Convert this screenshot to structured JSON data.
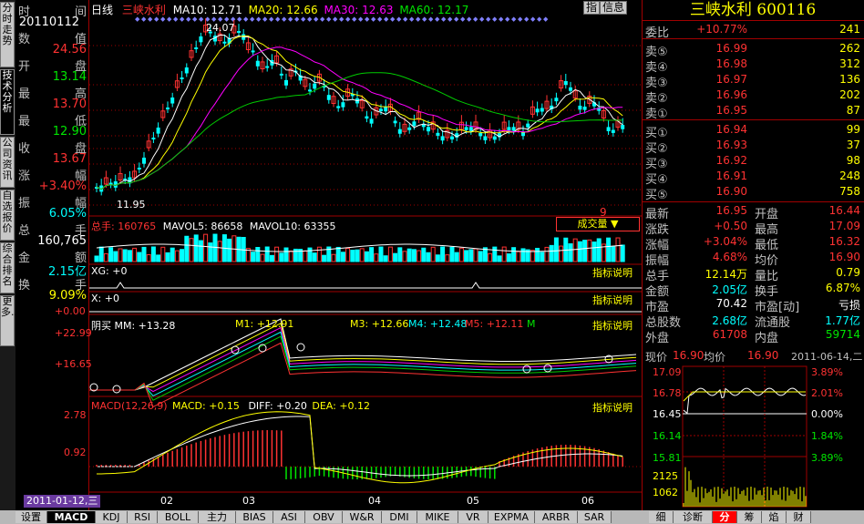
{
  "header": {
    "period_label": "日线",
    "name": "三峡水利",
    "ma10": "MA10: 12.71",
    "ma20": "MA20: 12.66",
    "ma30": "MA30: 12.63",
    "ma60": "MA60: 12.17"
  },
  "info": {
    "time_k": "时",
    "time_v": "间",
    "date": "20110112",
    "open_k": "数",
    "open_v": "值",
    "open_val": "24.56",
    "high_k": "开",
    "high_v": "盘",
    "high_val": "13.14",
    "low_k": "最",
    "low_v": "高",
    "low_val": "13.70",
    "close_k": "最",
    "close_v": "低",
    "close_val": "12.90",
    "chg_k": "收",
    "chg_v": "盘",
    "chg_val": "13.67",
    "pct_k": "涨",
    "pct_v": "幅",
    "pct_val": "+3.40%",
    "amp_k": "振",
    "amp_v": "幅",
    "amp_val": "6.05%",
    "vol_k": "总",
    "vol_v": "手",
    "vol_val": "160,765",
    "amt_k": "金",
    "amt_v": "额",
    "amt_val": "2.15亿",
    "turn_k": "换",
    "turn_v": "手",
    "turn_val": "9.09%"
  },
  "left_tabs": [
    "分时走势",
    "技术分析",
    "公司资讯",
    "自选报价",
    "综合排名",
    "更多..."
  ],
  "chart": {
    "price_top_label": "24.07",
    "price_low_label": "11.95",
    "marker_label": "9",
    "vol_line": "总手: 160765",
    "vol_ma5": "MAVOL5: 86658",
    "vol_ma10": "MAVOL10: 63355",
    "vol_dropdown": "成交量 ▼",
    "xg_label": "XG: +0",
    "x_label": "X: +0",
    "buy_line": "阴买 MM: +13.28",
    "m1": "M1: +12.91",
    "m3": "M3: +12.66",
    "m4": "M4: +12.48",
    "m5": "M5: +12.11",
    "m_tail": "M",
    "buy_y1": "+22.99",
    "buy_y2": "+16.65",
    "buy_y0": "+0.00",
    "macd_line": "MACD(12,26,9)",
    "macd_v": "MACD: +0.15",
    "diff_v": "DIFF: +0.20",
    "dea_v": "DEA: +0.12",
    "macd_y1": "2.78",
    "macd_y2": "0.92",
    "help": "指标说明",
    "date_badge": "2011-01-12,三",
    "months": [
      "02",
      "03",
      "04",
      "05",
      "06"
    ]
  },
  "bottom_tabs": [
    "设置",
    "MACD",
    "KDJ",
    "RSI",
    "BOLL",
    "主力",
    "BIAS",
    "ASI",
    "OBV",
    "W&R",
    "DMI",
    "MIKE",
    "VR",
    "EXPMA",
    "ARBR",
    "SAR"
  ],
  "right": {
    "btn_zhi": "指",
    "btn_info": "信息",
    "title": "三峡水利 600116",
    "weibi_k": "委比",
    "weibi_v": "+10.77%",
    "weibi_n": "241",
    "asks": [
      {
        "k": "卖⑤",
        "p": "16.99",
        "n": "262"
      },
      {
        "k": "卖④",
        "p": "16.98",
        "n": "312"
      },
      {
        "k": "卖③",
        "p": "16.97",
        "n": "136"
      },
      {
        "k": "卖②",
        "p": "16.96",
        "n": "202"
      },
      {
        "k": "卖①",
        "p": "16.95",
        "n": "87"
      }
    ],
    "bids": [
      {
        "k": "买①",
        "p": "16.94",
        "n": "99"
      },
      {
        "k": "买②",
        "p": "16.93",
        "n": "37"
      },
      {
        "k": "买③",
        "p": "16.92",
        "n": "98"
      },
      {
        "k": "买④",
        "p": "16.91",
        "n": "248"
      },
      {
        "k": "买⑤",
        "p": "16.90",
        "n": "758"
      }
    ],
    "stats": [
      {
        "a": "最新",
        "b": "16.95",
        "d": "开盘",
        "c": "16.44"
      },
      {
        "a": "涨跌",
        "b": "+0.50",
        "d": "最高",
        "c": "17.09"
      },
      {
        "a": "涨幅",
        "b": "+3.04%",
        "d": "最低",
        "c": "16.32"
      },
      {
        "a": "振幅",
        "b": "4.68%",
        "d": "均价",
        "c": "16.90"
      },
      {
        "a": "总手",
        "b": "12.14万",
        "d": "量比",
        "c": "0.79"
      },
      {
        "a": "金额",
        "b": "2.05亿",
        "d": "换手",
        "c": "6.87%"
      },
      {
        "a": "市盈",
        "b": "70.42",
        "d": "市盈[动]",
        "c": "亏损"
      },
      {
        "a": "总股数",
        "b": "2.68亿",
        "d": "流通股",
        "c": "1.77亿"
      },
      {
        "a": "外盘",
        "b": "61708",
        "d": "内盘",
        "c": "59714"
      }
    ],
    "mini": {
      "now_k": "现价",
      "now_v": "16.90",
      "avg_k": "均价",
      "avg_v": "16.90",
      "date": "2011-06-14,二",
      "y_left": [
        "17.09",
        "16.78",
        "16.45",
        "16.14",
        "15.81",
        "2125",
        "1062"
      ],
      "y_right": [
        "3.89%",
        "2.01%",
        "0.00%",
        "1.84%",
        "3.89%"
      ]
    },
    "tabs": [
      "细",
      "诊断",
      "分",
      "筹",
      "焰",
      "财"
    ]
  }
}
